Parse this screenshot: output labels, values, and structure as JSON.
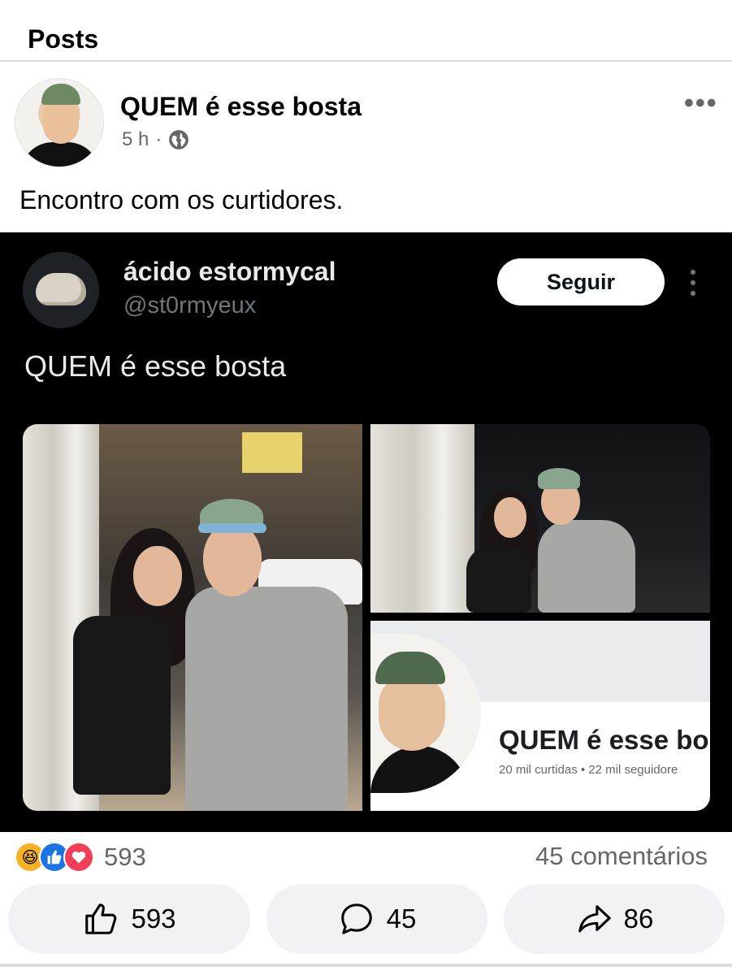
{
  "header": {
    "title": "Posts"
  },
  "post": {
    "author": "QUEM é esse bosta",
    "time": "5 h",
    "separator": "·",
    "privacy_icon": "globe-icon",
    "more_icon": "more-horizontal-icon",
    "text": "Encontro com os curtidores."
  },
  "tweet": {
    "display_name": "ácido estormycal",
    "handle": "@st0rmyeux",
    "follow_label": "Seguir",
    "text": "QUEM é esse bosta",
    "more_icon": "more-vertical-icon",
    "profile_card": {
      "name": "QUEM é esse bo",
      "stats": "20 mil curtidas • 22 mil seguidore"
    }
  },
  "engagement": {
    "reaction_icons": [
      "haha-icon",
      "like-icon",
      "love-icon"
    ],
    "reaction_count": "593",
    "comments": "45 comentários"
  },
  "actions": {
    "like_count": "593",
    "comment_count": "45",
    "share_count": "86"
  },
  "colors": {
    "tweet_bg": "#000000",
    "like_blue": "#1b74e4",
    "love_red": "#f33e58",
    "haha_yellow": "#f7b125",
    "button_bg": "#f0f2f5"
  }
}
